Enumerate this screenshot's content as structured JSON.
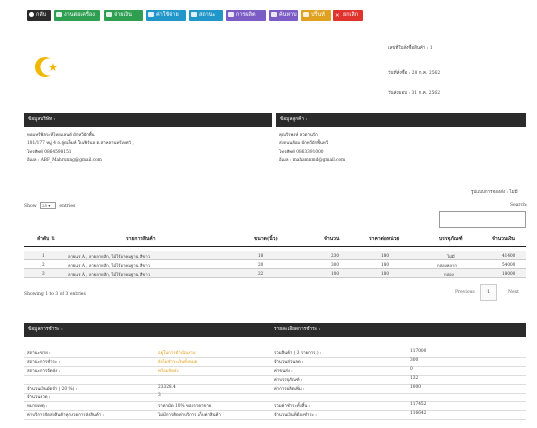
{
  "toolbar": {
    "buttons": [
      {
        "label": "กลับ",
        "color": "#2b2b2b",
        "icon": "back-icon"
      },
      {
        "label": "งานต่อเครื่อง",
        "color": "#2e9e50",
        "icon": "list-icon"
      },
      {
        "label": "จ่ายเงิน",
        "color": "#2e9e50",
        "icon": "money-icon"
      },
      {
        "label": "ค่าใช้จ่าย",
        "color": "#2196c9",
        "icon": "receipt-icon"
      },
      {
        "label": "สถานะ",
        "color": "#2196c9",
        "icon": "status-icon"
      },
      {
        "label": "การผลิต",
        "color": "#7b5cc4",
        "icon": "factory-icon"
      },
      {
        "label": "ค้นหาบ",
        "color": "#7b5cc4",
        "icon": "search-icon"
      },
      {
        "label": "ปริ้นท์",
        "color": "#e0a020",
        "icon": "print-icon"
      },
      {
        "label": "ยกเลิก",
        "color": "#e0332e",
        "icon": "cancel-icon"
      }
    ]
  },
  "header": {
    "logo_color": "#f0b800",
    "doc_no": "เลขที่ใบสั่งซื้อสินค้า : 1",
    "order_date": "วันที่สั่งซื้อ : 28 ก.ค. 2562",
    "delivery_date": "วันส่งมอบ : 31 ก.ค. 2562"
  },
  "seller": {
    "title": "ข้อมูลบริษัท :",
    "lines": [
      "หอมหรีพิลระทีไทยแลนด์ ผักหวีผักพื้น",
      "181/177 หมู่ 4 ถ.ลู่ตเล็มห์ ใบเฟิร์นล ต.สาหลานทรีเทศว์ ,",
      "โทรศัพท์ 0864598151",
      "อีเมล : ABF_Mahrunng@gmail.com"
    ]
  },
  "customer": {
    "title": "ข้อมูลลูกค้า :",
    "lines": [
      "คุณริรพงษ์ ลวดานรัก",
      "ส่งถนนล้อม ผักหวีผักพื้นหวี",
      "โทรศัพท์ 0863391000",
      "อีเมล : mahamnmd@gmail.com"
    ]
  },
  "delivery_type": "รูปแบบการจองส่ง : ไม่มี",
  "table_controls": {
    "show_label": "Show",
    "show_value": "25",
    "entries_label": "entries",
    "search_label": "Search:"
  },
  "table": {
    "headers": [
      "ลำดับ",
      "รายการสินค้า",
      "ขนาด(นิ้ว)",
      "จำนวน",
      "ราคาต่อหน่วย",
      "บรรจุภัณฑ์",
      "จำนวนเงิน"
    ],
    "rows": [
      [
        "1",
        "ลายเเร A , ลายลายสัก, ไม้ไร้อาคมฐาน สีขาว",
        "18",
        "230",
        "180",
        "ไม่มี",
        "41400"
      ],
      [
        "2",
        "ลายเเร A , ลายลายสัก, ไม้ไร้อาคมฐาน สีขาว",
        "20",
        "300",
        "180",
        "กล่องหลาก",
        "54000"
      ],
      [
        "3",
        "ลายเเร A , ลายลายสัก, ไม้ไร้อาคมฐาน สีขาว",
        "22",
        "100",
        "180",
        "กล่อง",
        "18000"
      ]
    ]
  },
  "table_footer": {
    "info": "Showing 1 to 3 of 3 entries",
    "previous": "Previous",
    "page": "1",
    "next": "Next"
  },
  "payment": {
    "title": "ข้อมูลการชำระ :",
    "rows": [
      {
        "label": "สถานะขาย :",
        "value": "อยู่ในการดำเนินงาน",
        "highlight": true
      },
      {
        "label": "สถานะการชำระ :",
        "value": "ยังไม่ชำระเงินทั้งหมด",
        "highlight": true
      },
      {
        "label": "สถานะการจัดส่ง :",
        "value": "พร้อมจัดส่ง",
        "highlight": true
      },
      {
        "label": "",
        "value": "",
        "highlight": false
      },
      {
        "label": "จำนวนเงินมัดจำ ( 20 %) :",
        "value": "23328.4",
        "highlight": false
      },
      {
        "label": "จำนวนงวด :",
        "value": "3",
        "highlight": false
      },
      {
        "label": "หมายเหตุ :",
        "value": "ราคามัด 10% ของราคาขาย",
        "highlight": false
      },
      {
        "label": "ค่าบริการจัดส่งสินค้าทุกงวดการส่งสินค้า :",
        "value": "ไม่มีการคิดค่าบริการ เก็บค่าสินค้า",
        "highlight": false
      }
    ]
  },
  "summary": {
    "title": "รายละเอียดการชำระ :",
    "rows": [
      {
        "label": "รวมสินค้า ( 3 รายการ ) :",
        "value": "117000"
      },
      {
        "label": "จำนวนส่วนลด :",
        "value": "300"
      },
      {
        "label": "ค่าขนส่ง :",
        "value": "0"
      },
      {
        "label": "ค่าบรรจุภัณฑ์ :",
        "value": "132"
      },
      {
        "label": "ค่าการผลิตเพิ่ม :",
        "value": "1000"
      },
      {
        "label": "",
        "value": ""
      },
      {
        "label": "รวมค่าชำระทั้งสิ้น :",
        "value": "117452"
      },
      {
        "label": "จำนวนเงินที่ต้องชำระ :",
        "value": "116642"
      }
    ]
  }
}
